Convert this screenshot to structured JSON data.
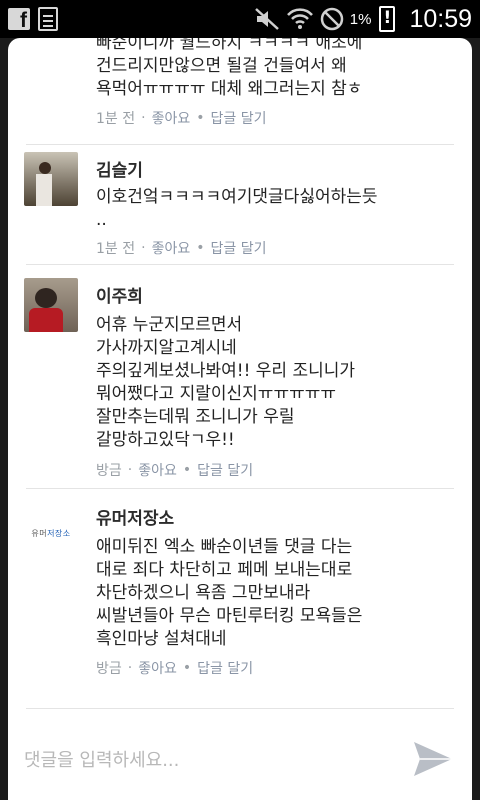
{
  "status_bar": {
    "battery_percent": "1%",
    "time": "10:59",
    "icons": [
      "facebook-icon",
      "file-icon",
      "mute-icon",
      "wifi-icon",
      "blocked-icon",
      "battery-icon"
    ]
  },
  "comments": [
    {
      "name": "",
      "lines": [
        "빠순이니까 월드하지 ㅋㅋㅋㅋ 애초에",
        "건드리지만않으면 될걸 건들여서 왜",
        "욕먹어ㅠㅠㅠㅠ 대체 왜그러는지 참ㅎ"
      ],
      "time": "1분 전",
      "like": "좋아요",
      "reply": "답글 달기"
    },
    {
      "name": "김슬기",
      "lines": [
        "이호건엌ㅋㅋㅋㅋ여기댓글다싫어하는듯",
        ".."
      ],
      "time": "1분 전",
      "like": "좋아요",
      "reply": "답글 달기"
    },
    {
      "name": "이주희",
      "lines": [
        "어휴 누군지모르면서",
        "가사까지알고계시네",
        "주의깊게보셨나봐여!! 우리 조니니가",
        "뭐어쨌다고 지랄이신지ㅠㅠㅠㅠㅠ",
        "잘만추는데뭐 조니니가 우릴",
        "갈망하고있닥ㄱ우!!"
      ],
      "time": "방금",
      "like": "좋아요",
      "reply": "답글 달기"
    },
    {
      "name": "유머저장소",
      "avatar_text_a": "유머",
      "avatar_text_b": "저장소",
      "lines": [
        "애미뒤진 엑소 빠순이년들 댓글 다는",
        "대로 죄다 차단히고 페메 보내는대로",
        "차단하겠으니 욕좀 그만보내라",
        "씨발년들아 무슨 마틴루터킹 모욕들은",
        "흑인마냥 설쳐대네"
      ],
      "time": "방금",
      "like": "좋아요",
      "reply": "답글 달기"
    }
  ],
  "composer": {
    "placeholder": "댓글을 입력하세요...",
    "send_icon": "send-icon"
  },
  "colors": {
    "panel_bg": "#ffffff",
    "meta_text": "#9aa0a6",
    "status_bar_bg": "#000000"
  }
}
